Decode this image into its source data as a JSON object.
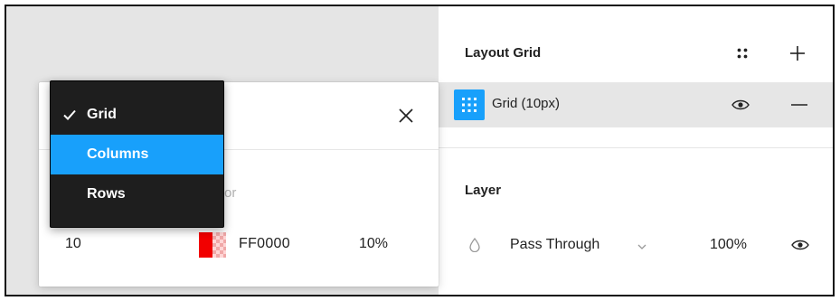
{
  "layout_grid": {
    "title": "Layout Grid",
    "grids": [
      {
        "label": "Grid (10px)"
      }
    ]
  },
  "layer": {
    "title": "Layer",
    "blend_mode": "Pass Through",
    "opacity": "100%"
  },
  "grid_popup": {
    "ghost_label": "or",
    "size": "10",
    "color_hex": "FF0000",
    "opacity": "10%",
    "color": "#ff0000"
  },
  "grid_type_menu": {
    "items": [
      {
        "label": "Grid",
        "checked": true
      },
      {
        "label": "Columns",
        "highlighted": true
      },
      {
        "label": "Rows"
      }
    ]
  },
  "accent_color": "#18a0fb"
}
